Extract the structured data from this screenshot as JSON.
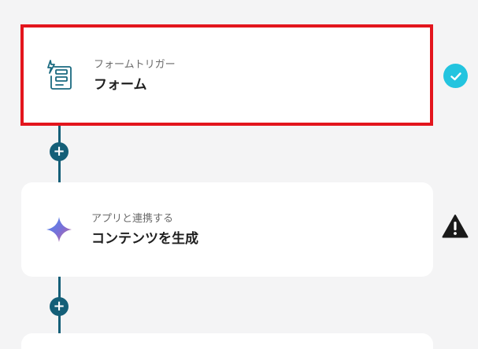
{
  "flow": {
    "steps": [
      {
        "subtitle": "フォームトリガー",
        "title": "フォーム",
        "icon": "form-trigger-icon",
        "status": "check-icon",
        "selected": true
      },
      {
        "subtitle": "アプリと連携する",
        "title": "コンテンツを生成",
        "icon": "gemini-sparkle-icon",
        "status": "warning-icon",
        "selected": false
      }
    ],
    "add_button_label": "+"
  },
  "colors": {
    "connector": "#145f78",
    "selected_border": "#e3151d",
    "check_badge": "#23c4df",
    "warning": "#1a1a1a",
    "background": "#f4f4f5"
  }
}
